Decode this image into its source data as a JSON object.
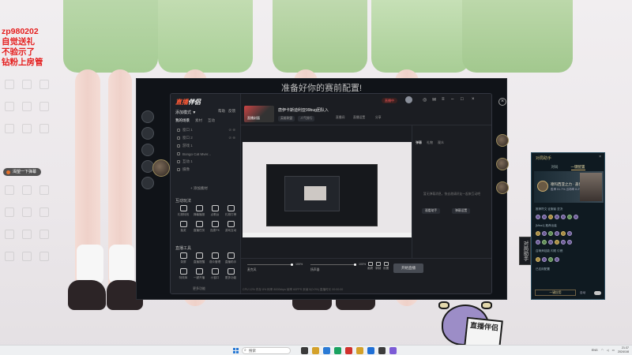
{
  "overlay": {
    "lines": [
      "zp980202",
      "自觉送礼",
      "不验示了",
      "钻粉上房管"
    ],
    "danmu": "渴望一下弹幕"
  },
  "client": {
    "title": "准备好你的赛前配置!",
    "close_icon": "close-icon"
  },
  "stream_app": {
    "logo_prefix": "直播",
    "logo_suffix": "伴侣",
    "side_link_a": "帮助",
    "side_link_b": "反馈",
    "scene_header": "添加模式 ▼",
    "source_tabs": [
      "我的场景",
      "素材",
      "互动"
    ],
    "scenes": [
      {
        "label": "窗口 1",
        "meta": "⊘ ⊕"
      },
      {
        "label": "窗口 2",
        "meta": "⊘ ⊕"
      },
      {
        "label": "游戏 1",
        "meta": ""
      },
      {
        "label": "Bongo Cat Mver...",
        "meta": ""
      },
      {
        "label": "互动 1",
        "meta": ""
      },
      {
        "label": "摄像",
        "meta": ""
      }
    ],
    "add_scene": "+ 添加素材",
    "section_interact": "互动玩法",
    "interact_tools": [
      "礼物特效",
      "弹幕播报",
      "点歌台",
      "礼物打榜",
      "抽奖",
      "直播任务",
      "连麦PK",
      "游戏互动"
    ],
    "section_tools": "直播工具",
    "live_tools": [
      "录屏",
      "直播提醒",
      "观众管理",
      "直播助手",
      "特效库",
      "一键开播",
      "小窗口",
      "更多功能"
    ],
    "more_tools": "更多功能",
    "thumb_label": "直播封面",
    "room_title": "唐伊卡斯迪利亚99bug团队入",
    "room_tags": [
      "英雄联盟",
      "人气排行"
    ],
    "meta_a": "直播间",
    "meta_b": "直播设置",
    "meta_c": "分享",
    "status": "直播中",
    "chat_tabs": [
      "弹幕",
      "礼物",
      "观众"
    ],
    "chat_empty": "暂无弹幕消息，快去邀请好友一起来互动吧",
    "chat_btn_a": "观看助手",
    "chat_btn_b": "弹幕设置",
    "volume_label": "麦克风",
    "volume_pct": "100%",
    "speaker_label": "扬声器",
    "speaker_pct": "100%",
    "bottom_icons": [
      "画质",
      "录制",
      "设置"
    ],
    "start_label": "开始直播",
    "status_bar": "CPU 12%   内存 8%   码率 8000kbps   帧率 60FPS   丢帧 0(0.0%)   直播时长 00:00:00"
  },
  "side_tab": "对局助手",
  "chatroom": {
    "title": "对局助手",
    "tabs": [
      "对局",
      "一键配置"
    ],
    "champ_name": "德玛西亚之力 · 盖伦",
    "champ_sub": "胜率 51.7%  出场率 8.2%",
    "line_a": "推荐符文  征服者  坚决",
    "line_b": "[Miss1] 推荐出装",
    "line_c": "召唤师技能 闪现 引燃",
    "line_d": "已应用配置",
    "input_label": "一键应用",
    "mode_label": "自动",
    "close_label": "×"
  },
  "mascot_sign": "直播伴侣",
  "taskbar": {
    "search_placeholder": "搜索",
    "lang": "ENG",
    "time": "21:37",
    "date": "2024/1/8"
  }
}
